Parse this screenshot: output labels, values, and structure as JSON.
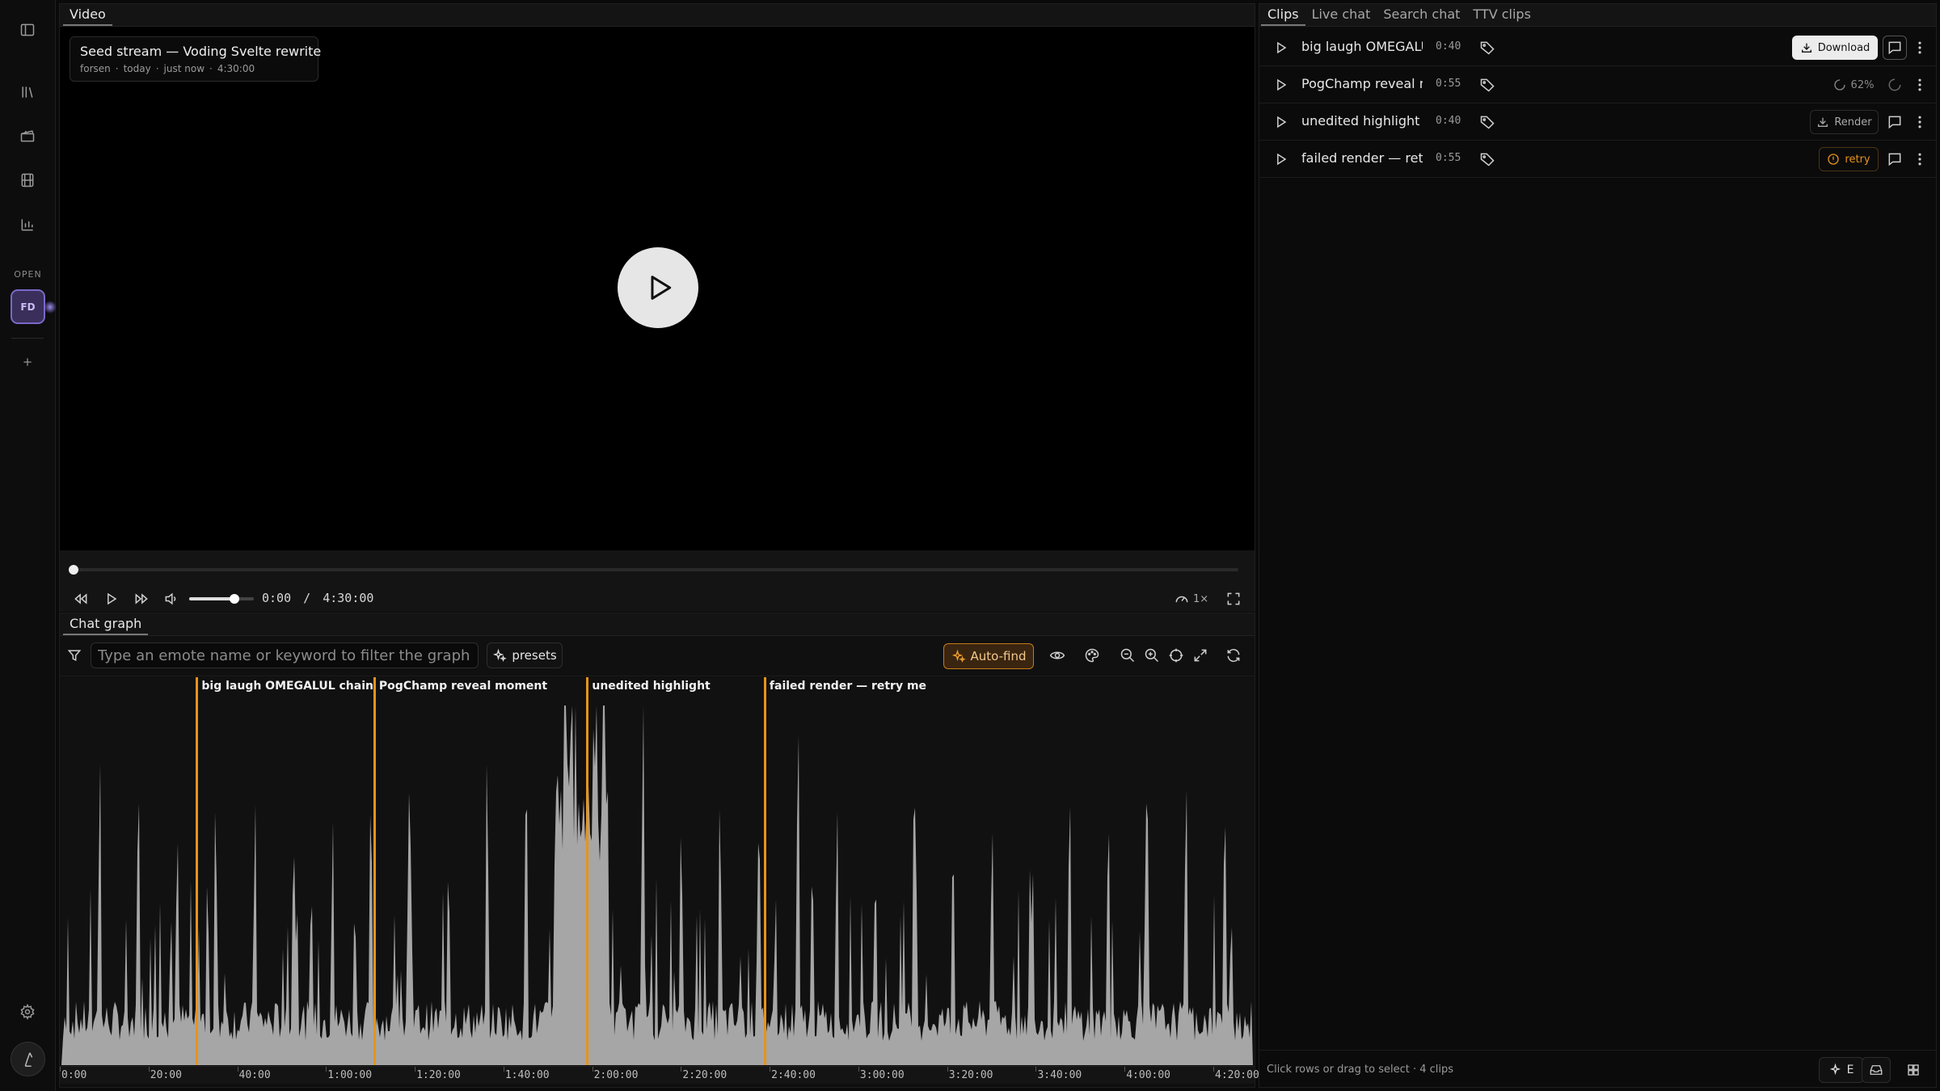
{
  "rail": {
    "open_label": "OPEN",
    "open_tile_text": "FD"
  },
  "video": {
    "tab_label": "Video",
    "title": "Seed stream — Voding Svelte rewrite",
    "meta": {
      "channel": "forsen",
      "date": "today",
      "updated": "just now",
      "duration": "4:30:00"
    },
    "time_current": "0:00",
    "time_separator": "/",
    "time_total": "4:30:00",
    "speed": "1×",
    "volume": 0.7,
    "progress": 0
  },
  "chat_graph": {
    "tab_label": "Chat graph",
    "filter_placeholder": "Type an emote name or keyword to filter the graph (↵ to",
    "presets_label": "presets",
    "autofind_label": "Auto-find",
    "accent_color": "#e8931a",
    "x_ticks": [
      "0:00",
      "20:00",
      "40:00",
      "1:00:00",
      "1:20:00",
      "1:40:00",
      "2:00:00",
      "2:20:00",
      "2:40:00",
      "3:00:00",
      "3:20:00",
      "3:40:00",
      "4:00:00",
      "4:20:00"
    ],
    "markers": [
      {
        "label": "big laugh OMEGALUL chain",
        "time_min": 30.5
      },
      {
        "label": "PogChamp reveal moment",
        "time_min": 70.5
      },
      {
        "label": "unedited highlight",
        "time_min": 118.5
      },
      {
        "label": "failed render — retry me",
        "time_min": 158.5
      }
    ],
    "x_range_min": [
      0,
      270
    ]
  },
  "clips": {
    "tabs": [
      "Clips",
      "Live chat",
      "Search chat",
      "TTV clips"
    ],
    "active_tab": 0,
    "rows": [
      {
        "title": "big laugh OMEGALUL chain",
        "duration": "0:40",
        "action": "Download",
        "state": "ready"
      },
      {
        "title": "PogChamp reveal moment",
        "duration": "0:55",
        "action": "62%",
        "state": "rendering"
      },
      {
        "title": "unedited highlight",
        "duration": "0:40",
        "action": "Render",
        "state": "unrendered"
      },
      {
        "title": "failed render — retry me",
        "duration": "0:55",
        "action": "retry",
        "state": "failed"
      }
    ],
    "footer_text": "Click rows or drag to select · 4 clips",
    "footer_export_label": "E"
  }
}
